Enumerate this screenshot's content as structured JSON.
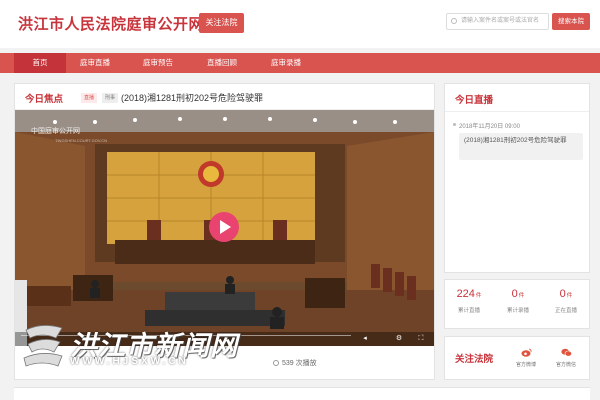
{
  "header": {
    "site_title": "洪江市人民法院庭审公开网",
    "follow_button": "关注法院",
    "search_placeholder": "请输入案件名或案号或法官名",
    "search_button": "搜索本院"
  },
  "nav": {
    "items": [
      {
        "label": "首页",
        "active": true
      },
      {
        "label": "庭审直播",
        "active": false
      },
      {
        "label": "庭审预告",
        "active": false
      },
      {
        "label": "直播回顾",
        "active": false
      },
      {
        "label": "庭审录播",
        "active": false
      }
    ]
  },
  "focus": {
    "heading": "今日焦点",
    "tag_live": "直播",
    "tag_type": "刑事",
    "case_title": "(2018)湘1281刑初202号危险驾驶罪",
    "video_watermark": "中国庭审公开网",
    "video_watermark_sub": "TINGSHEN.COURT.GOV.CN",
    "views": "539 次播放"
  },
  "logo_watermark": {
    "text": "洪江市新闻网",
    "url": "WWW.HJSXW.CN"
  },
  "today_live": {
    "heading": "今日直播",
    "time": "2018年11月20日 09:00",
    "item": "(2018)湘1281刑初202号危险驾驶罪"
  },
  "stats": [
    {
      "value": "224",
      "unit": "件",
      "label": "累计直播"
    },
    {
      "value": "0",
      "unit": "件",
      "label": "累计录播"
    },
    {
      "value": "0",
      "unit": "件",
      "label": "正在直播"
    }
  ],
  "follow_court": {
    "heading": "关注法院",
    "weibo": "官方微博",
    "wechat": "官方微信"
  },
  "colors": {
    "brand_red": "#d9534f",
    "title_red": "#c8343b",
    "play_pink": "#e8446f"
  }
}
